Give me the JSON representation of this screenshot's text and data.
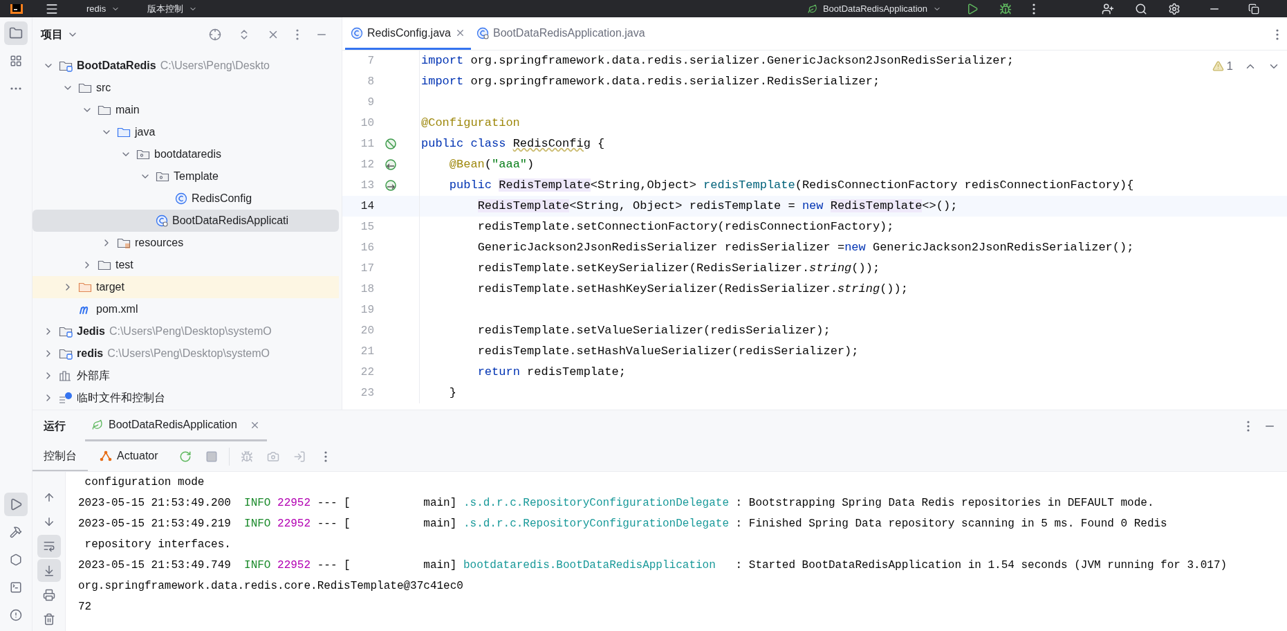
{
  "top_bar": {
    "project": "redis",
    "vcs": "版本控制",
    "run_config": "BootDataRedisApplication"
  },
  "project_panel": {
    "title": "项目",
    "tree": [
      {
        "label": "BootDataRedis",
        "path": "C:\\Users\\Peng\\Deskto",
        "kind": "module",
        "bold": true,
        "expanded": true,
        "selected": false,
        "children": [
          {
            "label": "src",
            "kind": "folder",
            "expanded": true,
            "selected": false,
            "children": [
              {
                "label": "main",
                "kind": "folder",
                "expanded": true,
                "selected": false,
                "children": [
                  {
                    "label": "java",
                    "kind": "source",
                    "expanded": true,
                    "selected": false,
                    "children": [
                      {
                        "label": "bootdataredis",
                        "kind": "package",
                        "expanded": true,
                        "selected": false,
                        "children": [
                          {
                            "label": "Template",
                            "kind": "package",
                            "expanded": true,
                            "selected": false,
                            "children": [
                              {
                                "label": "RedisConfig",
                                "kind": "class",
                                "selected": false
                              }
                            ]
                          },
                          {
                            "label": "BootDataRedisApplicati",
                            "kind": "app-class",
                            "selected": true
                          }
                        ]
                      }
                    ]
                  },
                  {
                    "label": "resources",
                    "kind": "resources",
                    "expanded": false,
                    "selected": false
                  }
                ]
              },
              {
                "label": "test",
                "kind": "folder",
                "expanded": false,
                "selected": false
              }
            ]
          },
          {
            "label": "target",
            "kind": "excluded",
            "expanded": false,
            "selected": false
          },
          {
            "label": "pom.xml",
            "kind": "maven",
            "selected": false
          }
        ]
      },
      {
        "label": "Jedis",
        "path": "C:\\Users\\Peng\\Desktop\\systemO",
        "kind": "module",
        "bold": true,
        "expanded": false,
        "selected": false
      },
      {
        "label": "redis",
        "path": "C:\\Users\\Peng\\Desktop\\systemO",
        "kind": "module",
        "bold": true,
        "expanded": false,
        "selected": false
      },
      {
        "label": "外部库",
        "kind": "library",
        "expanded": false,
        "selected": false
      },
      {
        "label": "临时文件和控制台",
        "kind": "scratch",
        "expanded": false,
        "selected": false
      }
    ]
  },
  "editor": {
    "tabs": [
      {
        "label": "RedisConfig.java",
        "kind": "class",
        "selected": true,
        "closable": true
      },
      {
        "label": "BootDataRedisApplication.java",
        "kind": "app-class",
        "selected": false,
        "closable": false
      }
    ],
    "warnings": "1",
    "lines": [
      {
        "number": "7",
        "kind": "plain",
        "current": false,
        "tokens": [
          {
            "kind": "keyword",
            "text": "import"
          },
          {
            "kind": "plain",
            "text": " org.springframework.data.redis.serializer.GenericJackson2JsonRedisSerializer;"
          }
        ]
      },
      {
        "number": "8",
        "kind": "plain",
        "current": false,
        "tokens": [
          {
            "kind": "keyword",
            "text": "import"
          },
          {
            "kind": "plain",
            "text": " org.springframework.data.redis.serializer.RedisSerializer;"
          }
        ]
      },
      {
        "number": "9",
        "kind": "plain",
        "current": false
      },
      {
        "number": "10",
        "kind": "plain",
        "current": false,
        "tokens": [
          {
            "kind": "annotation",
            "text": "@Configuration"
          }
        ]
      },
      {
        "number": "11",
        "kind": "config",
        "current": false,
        "tokens": [
          {
            "kind": "keyword",
            "text": "public class "
          },
          {
            "kind": "warning",
            "text": "RedisConfig"
          },
          {
            "kind": "plain",
            "text": " {"
          }
        ]
      },
      {
        "number": "12",
        "kind": "bean-in",
        "current": false,
        "tokens": [
          {
            "kind": "annotation",
            "text": "    @Bean"
          },
          {
            "kind": "plain",
            "text": "("
          },
          {
            "kind": "string",
            "text": "\"aaa\""
          },
          {
            "kind": "plain",
            "text": ")"
          }
        ]
      },
      {
        "number": "13",
        "kind": "bean-out",
        "current": false,
        "tokens": [
          {
            "kind": "keyword",
            "text": "    public "
          },
          {
            "kind": "usage",
            "text": "RedisTemplate"
          },
          {
            "kind": "plain",
            "text": "<String,Object> "
          },
          {
            "kind": "method",
            "text": "redisTemplate"
          },
          {
            "kind": "plain",
            "text": "(RedisConnectionFactory redisConnectionFactory){"
          }
        ]
      },
      {
        "number": "14",
        "kind": "plain",
        "current": true,
        "tokens": [
          {
            "kind": "usage",
            "text": "        RedisTemplate"
          },
          {
            "kind": "plain",
            "text": "<String, Object> redisTemplate = "
          },
          {
            "kind": "keyword",
            "text": "new "
          },
          {
            "kind": "usage",
            "text": "RedisTemplate"
          },
          {
            "kind": "plain",
            "text": "<>();"
          }
        ]
      },
      {
        "number": "15",
        "kind": "plain",
        "current": false,
        "tokens": [
          {
            "kind": "plain",
            "text": "        redisTemplate.setConnectionFactory(redisConnectionFactory);"
          }
        ]
      },
      {
        "number": "16",
        "kind": "plain",
        "current": false,
        "tokens": [
          {
            "kind": "plain",
            "text": "        GenericJackson2JsonRedisSerializer redisSerializer ="
          },
          {
            "kind": "keyword",
            "text": "new"
          },
          {
            "kind": "plain",
            "text": " GenericJackson2JsonRedisSerializer();"
          }
        ]
      },
      {
        "number": "17",
        "kind": "plain",
        "current": false,
        "tokens": [
          {
            "kind": "plain",
            "text": "        redisTemplate.setKeySerializer(RedisSerializer."
          },
          {
            "kind": "static",
            "text": "string"
          },
          {
            "kind": "plain",
            "text": "());"
          }
        ]
      },
      {
        "number": "18",
        "kind": "plain",
        "current": false,
        "tokens": [
          {
            "kind": "plain",
            "text": "        redisTemplate.setHashKeySerializer(RedisSerializer."
          },
          {
            "kind": "static",
            "text": "string"
          },
          {
            "kind": "plain",
            "text": "());"
          }
        ]
      },
      {
        "number": "19",
        "kind": "plain",
        "current": false
      },
      {
        "number": "20",
        "kind": "plain",
        "current": false,
        "tokens": [
          {
            "kind": "plain",
            "text": "        redisTemplate.setValueSerializer(redisSerializer);"
          }
        ]
      },
      {
        "number": "21",
        "kind": "plain",
        "current": false,
        "tokens": [
          {
            "kind": "plain",
            "text": "        redisTemplate.setHashValueSerializer(redisSerializer);"
          }
        ]
      },
      {
        "number": "22",
        "kind": "plain",
        "current": false,
        "tokens": [
          {
            "kind": "keyword",
            "text": "        return"
          },
          {
            "kind": "plain",
            "text": " redisTemplate;"
          }
        ]
      },
      {
        "number": "23",
        "kind": "plain",
        "current": false,
        "tokens": [
          {
            "kind": "plain",
            "text": "    }"
          }
        ]
      }
    ]
  },
  "run_panel": {
    "title": "运行",
    "tabs": [
      {
        "label": "BootDataRedisApplication",
        "selected": true
      }
    ],
    "console_tabs": [
      {
        "label": "控制台",
        "kind": "plain",
        "selected": true
      },
      {
        "label": "Actuator",
        "kind": "actuator",
        "selected": false
      }
    ],
    "console": [
      {
        "segments": [
          {
            "kind": "plain",
            "text": " configuration mode"
          }
        ]
      },
      {
        "segments": [
          {
            "kind": "plain",
            "text": "2023-05-15 21:53:49.200  "
          },
          {
            "kind": "level",
            "text": "INFO "
          },
          {
            "kind": "pid",
            "text": "22952"
          },
          {
            "kind": "plain",
            "text": " --- [           main] "
          },
          {
            "kind": "logger",
            "text": ".s.d.r.c.RepositoryConfigurationDelegate"
          },
          {
            "kind": "plain",
            "text": " : Bootstrapping Spring Data Redis repositories in DEFAULT mode."
          }
        ]
      },
      {
        "segments": [
          {
            "kind": "plain",
            "text": "2023-05-15 21:53:49.219  "
          },
          {
            "kind": "level",
            "text": "INFO "
          },
          {
            "kind": "pid",
            "text": "22952"
          },
          {
            "kind": "plain",
            "text": " --- [           main] "
          },
          {
            "kind": "logger",
            "text": ".s.d.r.c.RepositoryConfigurationDelegate"
          },
          {
            "kind": "plain",
            "text": " : Finished Spring Data repository scanning in 5 ms. Found 0 Redis"
          }
        ]
      },
      {
        "segments": [
          {
            "kind": "plain",
            "text": " repository interfaces."
          }
        ]
      },
      {
        "segments": [
          {
            "kind": "plain",
            "text": "2023-05-15 21:53:49.749  "
          },
          {
            "kind": "level",
            "text": "INFO "
          },
          {
            "kind": "pid",
            "text": "22952"
          },
          {
            "kind": "plain",
            "text": " --- [           main] "
          },
          {
            "kind": "logger",
            "text": "bootdataredis.BootDataRedisApplication"
          },
          {
            "kind": "plain",
            "text": "   : Started BootDataRedisApplication in 1.54 seconds (JVM running for 3.017)"
          }
        ]
      },
      {
        "segments": [
          {
            "kind": "plain",
            "text": "org.springframework.data.redis.core.RedisTemplate@37c41ec0"
          }
        ]
      },
      {
        "segments": [
          {
            "kind": "plain",
            "text": "72"
          }
        ]
      }
    ]
  }
}
